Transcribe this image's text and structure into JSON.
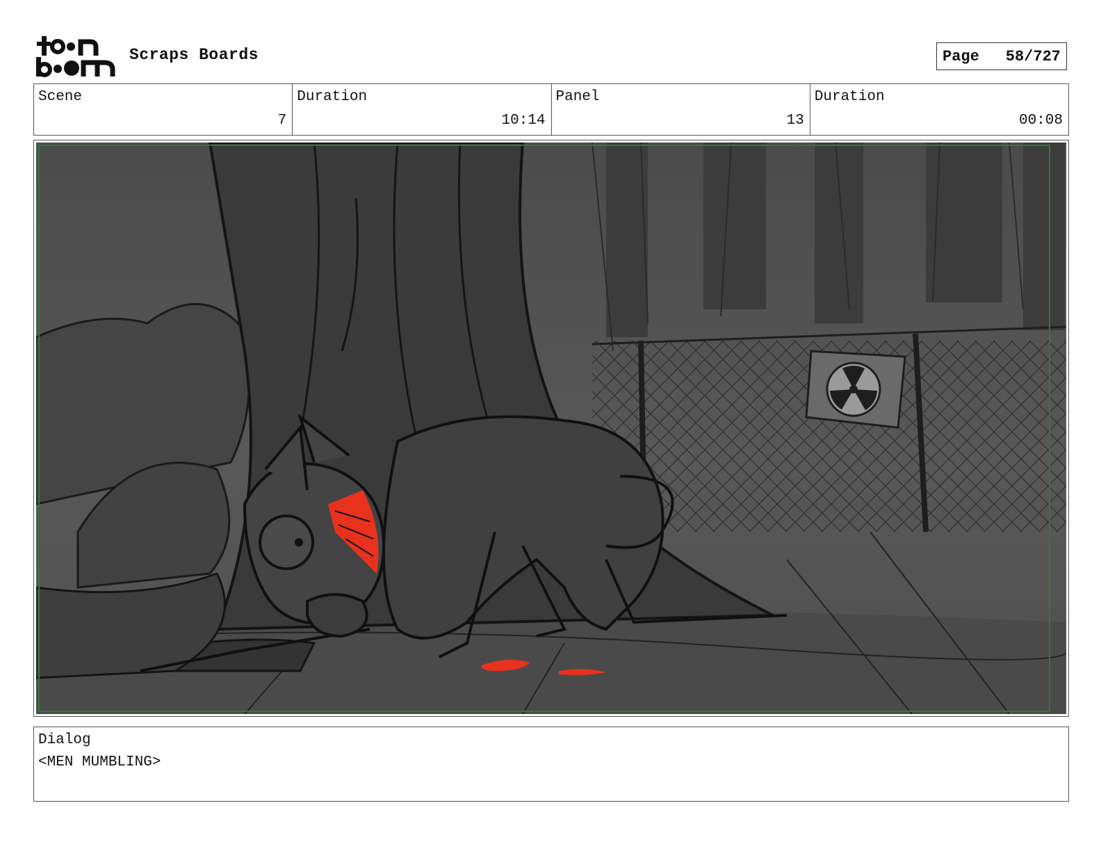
{
  "header": {
    "logo": {
      "line1": "toon",
      "line2": "boom"
    },
    "project_title": "Scraps Boards",
    "page_label": "Page",
    "page_value": "58/727"
  },
  "info": {
    "scene_label": "Scene",
    "scene_value": "7",
    "scene_duration_label": "Duration",
    "scene_duration_value": "10:14",
    "panel_label": "Panel",
    "panel_value": "13",
    "panel_duration_label": "Duration",
    "panel_duration_value": "00:08"
  },
  "panel_image": {
    "icon": "radiation-sign-icon",
    "colors": {
      "shadow": "#4a4a4a",
      "blood": "#e8321e",
      "safe_area": "#2e7d32"
    }
  },
  "dialog": {
    "label": "Dialog",
    "text": "<MEN MUMBLING>"
  }
}
